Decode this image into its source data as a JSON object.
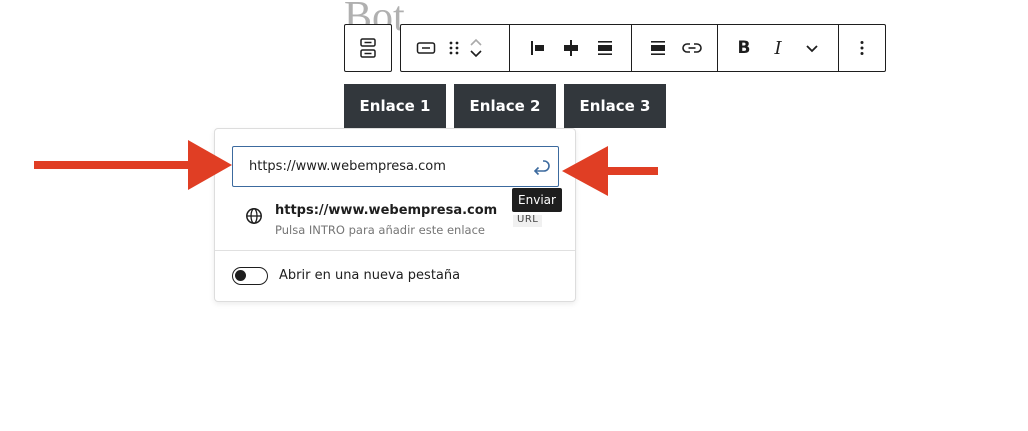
{
  "background_heading_fragment": "Bot",
  "block_toolbar": {
    "parent_icon": "buttons-parent-icon",
    "button_block_icon": "button-block-icon",
    "drag_icon": "drag-handle-icon",
    "move_up_icon": "chevron-up-icon",
    "move_down_icon": "chevron-down-icon",
    "justify_left_icon": "justify-left-icon",
    "justify_center_icon": "justify-center-icon",
    "justify_space_icon": "justify-space-between-icon",
    "align_icon": "align-none-icon",
    "link_icon": "link-icon",
    "bold_label": "B",
    "italic_label": "I",
    "more_formats_icon": "chevron-down-icon",
    "options_icon": "more-vertical-icon"
  },
  "buttons": [
    {
      "label": "Enlace 1"
    },
    {
      "label": "Enlace 2"
    },
    {
      "label": "Enlace 3"
    }
  ],
  "link_popover": {
    "url_value": "https://www.webempresa.com",
    "submit_icon": "enter-icon",
    "submit_tooltip": "Enviar",
    "suggestion": {
      "icon": "globe-icon",
      "title": "https://www.webempresa.com",
      "subtitle": "Pulsa INTRO para añadir este enlace",
      "type": "URL"
    },
    "new_tab_toggle": {
      "label": "Abrir en una nueva pestaña",
      "checked": false
    }
  },
  "colors": {
    "button_bg": "#32373c",
    "input_border": "#3c6a9e",
    "annotation_arrow": "#e03e24",
    "tooltip_bg": "#1e1e1e"
  }
}
